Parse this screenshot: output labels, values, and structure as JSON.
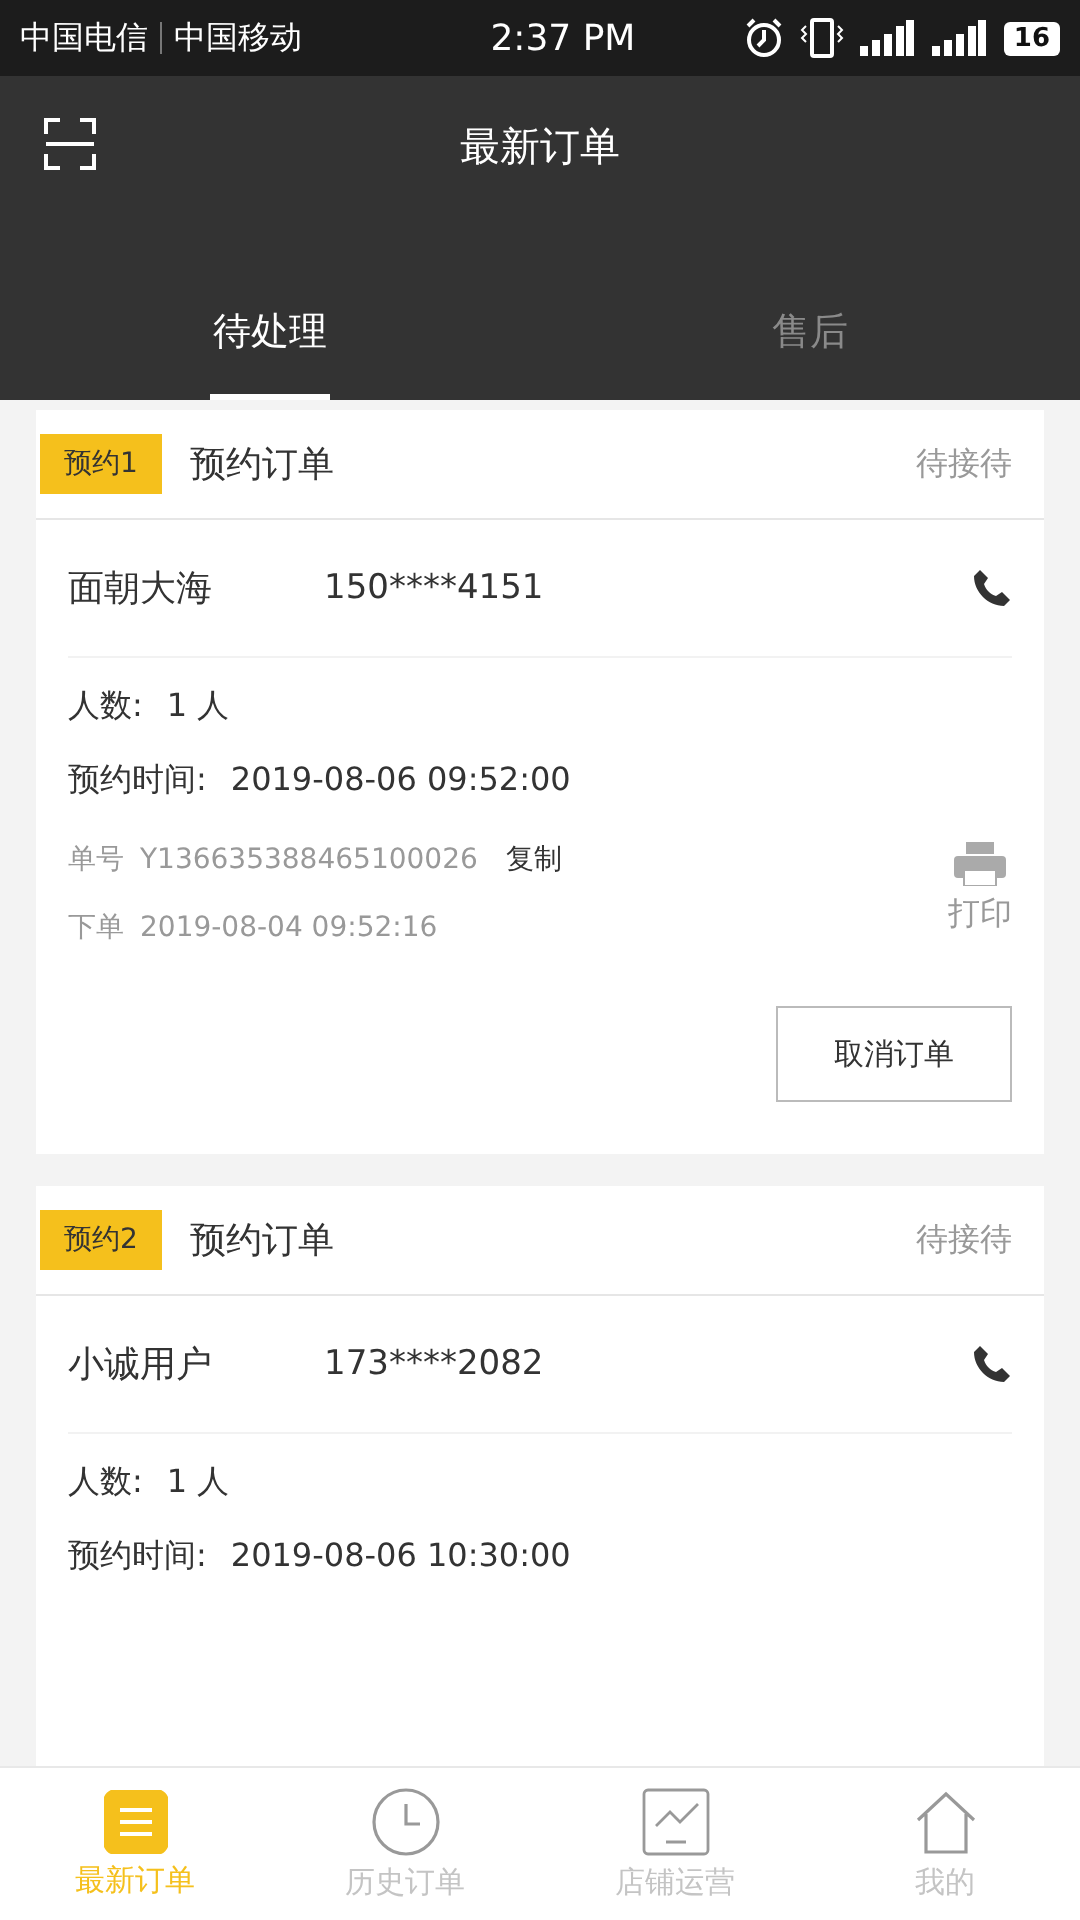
{
  "status_bar": {
    "carriers": [
      "中国电信",
      "中国移动"
    ],
    "time": "2:37 PM",
    "battery": "16"
  },
  "header": {
    "title": "最新订单"
  },
  "tabs": [
    {
      "label": "待处理",
      "selected": true
    },
    {
      "label": "售后",
      "selected": false
    }
  ],
  "orders": [
    {
      "badge": "预约1",
      "type": "预约订单",
      "status": "待接待",
      "name": "面朝大海",
      "phone": "150****4151",
      "people_label": "人数:",
      "people": "1 人",
      "time_label": "预约时间:",
      "time": "2019-08-06 09:52:00",
      "order_no_label": "单号",
      "order_no": "Y136635388465100026",
      "copy": "复制",
      "placed_label": "下单",
      "placed": "2019-08-04 09:52:16",
      "print": "打印",
      "action": "取消订单"
    },
    {
      "badge": "预约2",
      "type": "预约订单",
      "status": "待接待",
      "name": "小诚用户",
      "phone": "173****2082",
      "people_label": "人数:",
      "people": "1 人",
      "time_label": "预约时间:",
      "time": "2019-08-06 10:30:00"
    }
  ],
  "bottom_nav": [
    {
      "kind": "list",
      "label": "最新订单",
      "selected": true
    },
    {
      "kind": "clock",
      "label": "历史订单",
      "selected": false
    },
    {
      "kind": "chart",
      "label": "店铺运营",
      "selected": false
    },
    {
      "kind": "house",
      "label": "我的",
      "selected": false
    }
  ]
}
